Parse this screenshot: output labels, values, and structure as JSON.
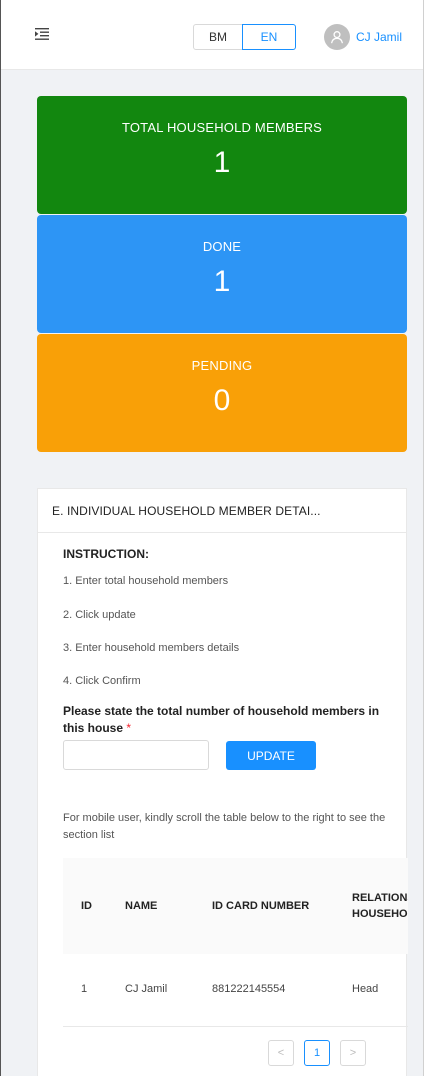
{
  "header": {
    "languages": {
      "bm": "BM",
      "en": "EN",
      "active": "EN"
    },
    "user_name": "CJ Jamil"
  },
  "stats": {
    "total": {
      "label": "TOTAL HOUSEHOLD MEMBERS",
      "value": "1"
    },
    "done": {
      "label": "DONE",
      "value": "1"
    },
    "pending": {
      "label": "PENDING",
      "value": "0"
    }
  },
  "section": {
    "title": "E. INDIVIDUAL HOUSEHOLD MEMBER DETAI...",
    "instruction_title": "INSTRUCTION:",
    "steps": [
      "1. Enter total household members",
      "2. Click update",
      "3. Enter household members details",
      "4. Click Confirm"
    ],
    "question": "Please state the total number of household members in this house",
    "required_mark": "*",
    "input_value": "",
    "update_label": "UPDATE",
    "mobile_note": "For mobile user, kindly scroll the table below to the right to see the section list"
  },
  "table": {
    "headers": [
      "ID",
      "NAME",
      "ID CARD NUMBER",
      "RELATIONSHIP TO HOUSEHOLD HEAD"
    ],
    "rows": [
      [
        "1",
        "CJ Jamil",
        "881222145554",
        "Head"
      ]
    ]
  },
  "pagination": {
    "prev": "<",
    "current": "1",
    "next": ">"
  },
  "colors": {
    "total": "#12870f",
    "done": "#2d95f5",
    "pending": "#f9a007",
    "accent": "#1890ff"
  }
}
